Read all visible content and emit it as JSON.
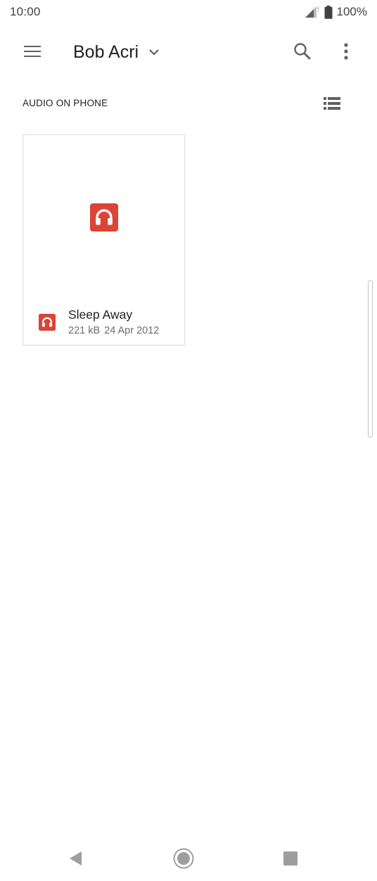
{
  "status_bar": {
    "time": "10:00",
    "battery": "100%",
    "icons": [
      "signal-icon",
      "battery-icon"
    ]
  },
  "app_bar": {
    "title": "Bob Acri",
    "icons": [
      "menu-icon",
      "chevron-down-icon",
      "search-icon",
      "more-vert-icon"
    ]
  },
  "section": {
    "header": "AUDIO ON PHONE",
    "view_toggle_icon": "list-view-icon"
  },
  "files": [
    {
      "name": "Sleep Away",
      "size": "221 kB",
      "date": "24 Apr 2012",
      "icon": "headphones-icon"
    }
  ],
  "nav_bar": {
    "icons": [
      "back-icon",
      "home-icon",
      "recents-icon"
    ]
  },
  "colors": {
    "accent_audio": "#db4437",
    "text_primary": "#212121",
    "text_secondary": "#6f6f6f",
    "icon_grey": "#616161",
    "nav_grey": "#9e9e9e"
  }
}
